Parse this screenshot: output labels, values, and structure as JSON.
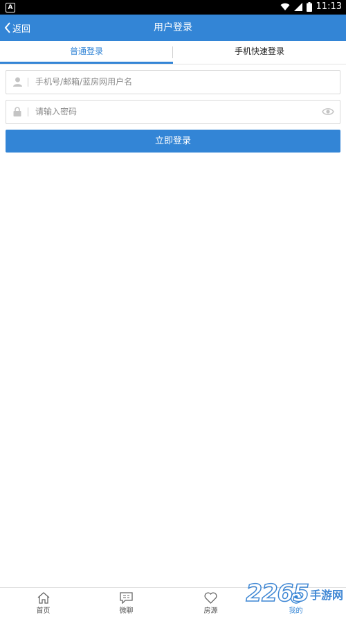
{
  "status_bar": {
    "app_badge": "A",
    "time": "11:13"
  },
  "navbar": {
    "back_label": "返回",
    "title": "用户登录"
  },
  "tabs": [
    {
      "label": "普通登录",
      "active": true
    },
    {
      "label": "手机快速登录",
      "active": false
    }
  ],
  "form": {
    "username_placeholder": "手机号/邮箱/蓝房网用户名",
    "username_value": "",
    "password_placeholder": "请输入密码",
    "password_value": "",
    "submit_label": "立即登录"
  },
  "bottom_nav": [
    {
      "label": "首页",
      "icon": "home-icon"
    },
    {
      "label": "微聊",
      "icon": "chat-icon"
    },
    {
      "label": "房源",
      "icon": "heart-icon"
    },
    {
      "label": "我的",
      "icon": "profile-icon",
      "active": true
    }
  ],
  "watermark": {
    "number": "2265",
    "text": "手游网"
  },
  "colors": {
    "accent": "#3385d6",
    "statusbar": "#000000"
  }
}
